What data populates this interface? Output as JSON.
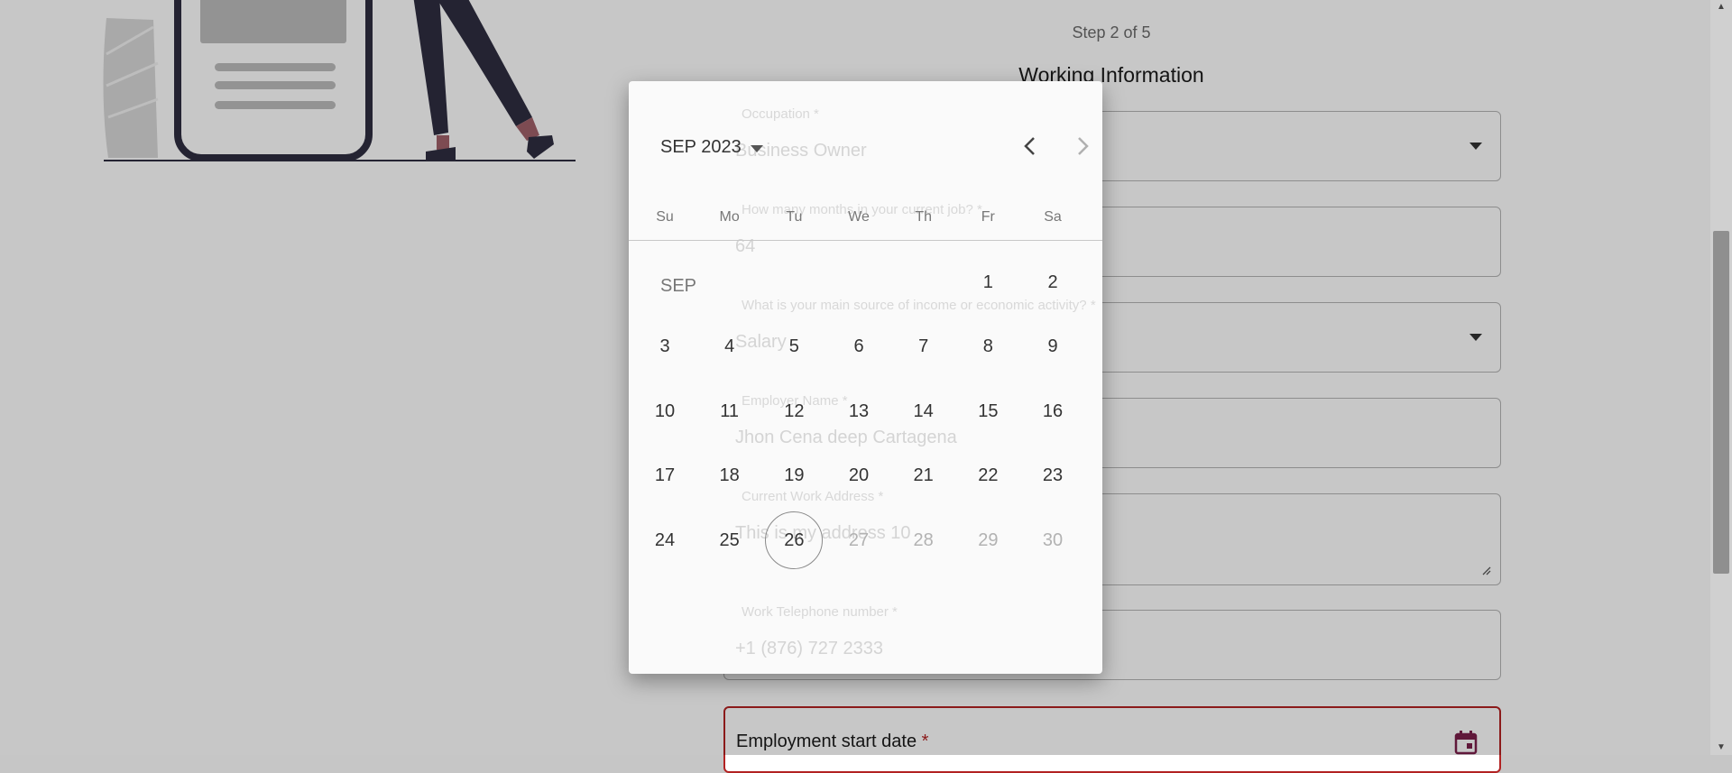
{
  "form": {
    "step_text": "Step 2 of 5",
    "section_title": "Working Information",
    "fields": [
      {
        "label": "Occupation *",
        "value": "Business Owner",
        "type": "select"
      },
      {
        "label": "How many months in your current job? *",
        "value": "64",
        "type": "text"
      },
      {
        "label": "What is your main source of income or economic activity? *",
        "value": "Salary",
        "type": "select"
      },
      {
        "label": "Employer Name *",
        "value": "Jhon Cena deep Cartagena",
        "type": "text"
      },
      {
        "label": "Current Work Address *",
        "value": "This is my address 10",
        "type": "textarea"
      },
      {
        "label": "Work Telephone number *",
        "value": "+1 (876) 727 2333",
        "type": "text"
      }
    ],
    "date_field": {
      "label": "Employment start date",
      "required_mark": "*",
      "icon": "calendar-icon"
    }
  },
  "picker": {
    "month_year": "SEP 2023",
    "month_label": "SEP",
    "weekdays": [
      "Su",
      "Mo",
      "Tu",
      "We",
      "Th",
      "Fr",
      "Sa"
    ],
    "first_weekday_index": 5,
    "days": [
      1,
      2,
      3,
      4,
      5,
      6,
      7,
      8,
      9,
      10,
      11,
      12,
      13,
      14,
      15,
      16,
      17,
      18,
      19,
      20,
      21,
      22,
      23,
      24,
      25,
      26,
      27,
      28,
      29,
      30
    ],
    "today": 26,
    "disabled_after": 26,
    "prev_icon": "chevron-left-icon",
    "next_icon": "chevron-right-icon",
    "dropdown_icon": "triangle-down-icon"
  },
  "colors": {
    "error_border": "#b22222",
    "calendar_icon": "#7b1f4b",
    "illustration_dark": "#2f2e41",
    "illustration_skin": "#a0616a"
  }
}
